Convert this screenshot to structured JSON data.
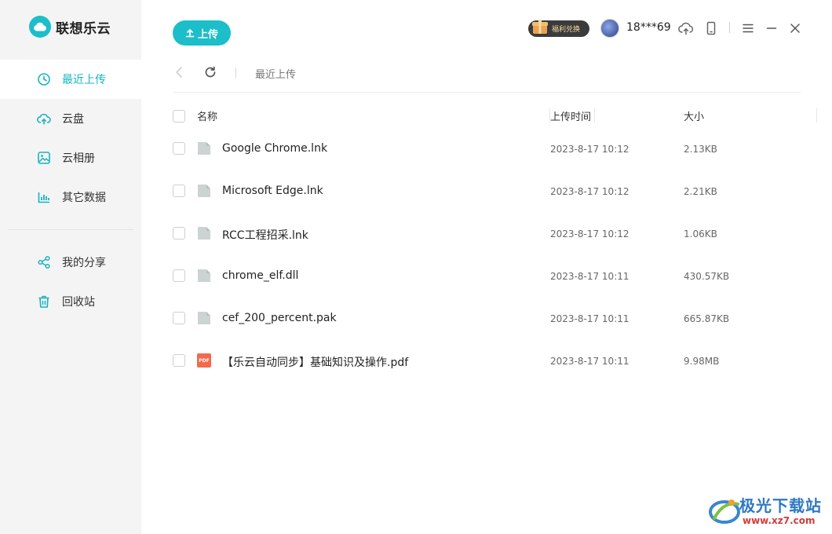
{
  "brand": {
    "name": "联想乐云"
  },
  "sidebar": {
    "items": [
      {
        "label": "最近上传",
        "icon": "clock-icon",
        "active": true
      },
      {
        "label": "云盘",
        "icon": "cloud-upload-icon"
      },
      {
        "label": "云相册",
        "icon": "photo-icon"
      },
      {
        "label": "其它数据",
        "icon": "bar-chart-icon"
      }
    ],
    "items2": [
      {
        "label": "我的分享",
        "icon": "share-icon"
      },
      {
        "label": "回收站",
        "icon": "trash-icon"
      }
    ]
  },
  "toolbar": {
    "upload_label": "上传",
    "welfare_label": "福利兑换",
    "username": "18***69"
  },
  "pathbar": {
    "current": "最近上传"
  },
  "table": {
    "headers": {
      "name": "名称",
      "time": "上传时间",
      "size": "大小"
    },
    "rows": [
      {
        "name": "Google Chrome.lnk",
        "time": "2023-8-17 10:12",
        "size": "2.13KB",
        "type": "file"
      },
      {
        "name": "Microsoft Edge.lnk",
        "time": "2023-8-17 10:12",
        "size": "2.21KB",
        "type": "file"
      },
      {
        "name": "RCC工程招采.lnk",
        "time": "2023-8-17 10:12",
        "size": "1.06KB",
        "type": "file"
      },
      {
        "name": "chrome_elf.dll",
        "time": "2023-8-17 10:11",
        "size": "430.57KB",
        "type": "file"
      },
      {
        "name": "cef_200_percent.pak",
        "time": "2023-8-17 10:11",
        "size": "665.87KB",
        "type": "file"
      },
      {
        "name": "【乐云自动同步】基础知识及操作.pdf",
        "time": "2023-8-17 10:11",
        "size": "9.98MB",
        "type": "pdf"
      }
    ]
  },
  "file_icons": {
    "pdf_label": "PDF"
  },
  "watermark": {
    "title": "极光下载站",
    "url": "www.xz7.com"
  },
  "colors": {
    "accent": "#1bbec9",
    "sidebar_bg": "#f4f4f4",
    "pdf": "#f26a4b"
  }
}
